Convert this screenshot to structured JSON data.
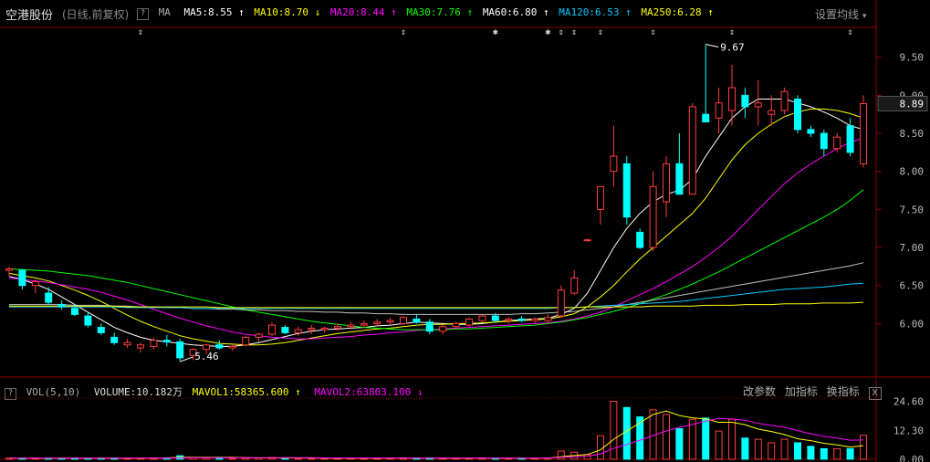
{
  "header": {
    "stock_name": "空港股份",
    "subtitle": "(日线,前复权)",
    "help_icon": "?",
    "ma_label": "MA",
    "ma_items": [
      {
        "label": "MA5:8.55",
        "arrow": "↑",
        "color": "#ffffff"
      },
      {
        "label": "MA10:8.70",
        "arrow": "↓",
        "color": "#ffff00"
      },
      {
        "label": "MA20:8.44",
        "arrow": "↑",
        "color": "#ff00ff"
      },
      {
        "label": "MA30:7.76",
        "arrow": "↑",
        "color": "#00ff00"
      },
      {
        "label": "MA60:6.80",
        "arrow": "↑",
        "color": "#ffffff"
      },
      {
        "label": "MA120:6.53",
        "arrow": "↑",
        "color": "#00c8ff"
      },
      {
        "label": "MA250:6.28",
        "arrow": "↑",
        "color": "#ffff00"
      }
    ],
    "settings_label": "设置均线",
    "settings_arrow": "▾"
  },
  "price_axis": {
    "ticks": [
      "9.50",
      "9.00",
      "8.50",
      "8.00",
      "7.50",
      "7.00",
      "6.50",
      "6.00"
    ],
    "current": "8.89"
  },
  "annotations": {
    "high_label": "9.67",
    "low_label": "5.46"
  },
  "volume": {
    "help_icon": "?",
    "label": "VOL(5,10)",
    "volume_value": "VOLUME:10.182万",
    "mavol1": "MAVOL1:58365.600",
    "mavol1_arrow": "↑",
    "mavol2": "MAVOL2:63803.100",
    "mavol2_arrow": "↓",
    "tools": [
      "改参数",
      "加指标",
      "换指标"
    ],
    "close": "X",
    "ticks": [
      "24.60",
      "12.30",
      "0.00"
    ]
  },
  "colors": {
    "up": "#ff3c3c",
    "down": "#00ffff",
    "grid": "#8b0000",
    "ma5": "#ffffff",
    "ma10": "#ffff00",
    "ma20": "#ff00ff",
    "ma30": "#00ff00",
    "ma60": "#ffffff",
    "ma120": "#00c8ff",
    "ma250": "#ffff00"
  },
  "chart_data": {
    "type": "candlestick",
    "y_range": [
      5.3,
      9.8
    ],
    "candles": [
      [
        6.7,
        6.75,
        6.62,
        6.72
      ],
      [
        6.7,
        6.72,
        6.45,
        6.5
      ],
      [
        6.5,
        6.58,
        6.4,
        6.55
      ],
      [
        6.4,
        6.48,
        6.25,
        6.28
      ],
      [
        6.25,
        6.3,
        6.18,
        6.22
      ],
      [
        6.2,
        6.25,
        6.1,
        6.12
      ],
      [
        6.1,
        6.15,
        5.95,
        5.98
      ],
      [
        5.95,
        6.0,
        5.85,
        5.88
      ],
      [
        5.82,
        5.88,
        5.72,
        5.75
      ],
      [
        5.72,
        5.8,
        5.68,
        5.75
      ],
      [
        5.68,
        5.75,
        5.62,
        5.72
      ],
      [
        5.7,
        5.82,
        5.66,
        5.78
      ],
      [
        5.78,
        5.85,
        5.7,
        5.76
      ],
      [
        5.76,
        5.8,
        5.5,
        5.55
      ],
      [
        5.58,
        5.68,
        5.52,
        5.66
      ],
      [
        5.66,
        5.74,
        5.6,
        5.72
      ],
      [
        5.72,
        5.78,
        5.66,
        5.68
      ],
      [
        5.68,
        5.72,
        5.64,
        5.7
      ],
      [
        5.72,
        5.84,
        5.7,
        5.82
      ],
      [
        5.82,
        5.88,
        5.76,
        5.86
      ],
      [
        5.86,
        6.02,
        5.84,
        5.98
      ],
      [
        5.95,
        5.98,
        5.86,
        5.88
      ],
      [
        5.88,
        5.96,
        5.84,
        5.92
      ],
      [
        5.92,
        5.98,
        5.86,
        5.94
      ],
      [
        5.92,
        5.96,
        5.88,
        5.94
      ],
      [
        5.94,
        6.0,
        5.9,
        5.96
      ],
      [
        5.96,
        6.02,
        5.92,
        5.98
      ],
      [
        5.98,
        6.04,
        5.94,
        6.0
      ],
      [
        6.0,
        6.06,
        5.96,
        6.02
      ],
      [
        6.02,
        6.08,
        5.98,
        6.04
      ],
      [
        6.0,
        6.1,
        5.98,
        6.08
      ],
      [
        6.06,
        6.12,
        6.0,
        6.02
      ],
      [
        6.02,
        6.06,
        5.86,
        5.9
      ],
      [
        5.9,
        5.98,
        5.86,
        5.96
      ],
      [
        5.96,
        6.02,
        5.92,
        6.0
      ],
      [
        5.98,
        6.08,
        5.96,
        6.06
      ],
      [
        6.04,
        6.12,
        6.02,
        6.1
      ],
      [
        6.1,
        6.14,
        6.02,
        6.04
      ],
      [
        6.04,
        6.08,
        6.0,
        6.06
      ],
      [
        6.06,
        6.1,
        6.02,
        6.04
      ],
      [
        6.04,
        6.08,
        6.0,
        6.06
      ],
      [
        6.04,
        6.12,
        6.0,
        6.08
      ],
      [
        6.1,
        6.5,
        6.08,
        6.44
      ],
      [
        6.4,
        6.7,
        6.38,
        6.6
      ],
      [
        7.1,
        7.12,
        7.08,
        7.1
      ],
      [
        7.5,
        7.8,
        7.3,
        7.8
      ],
      [
        8.0,
        8.6,
        7.8,
        8.2
      ],
      [
        8.1,
        8.2,
        7.3,
        7.4
      ],
      [
        7.2,
        7.25,
        6.98,
        7.0
      ],
      [
        7.0,
        8.0,
        6.95,
        7.8
      ],
      [
        7.6,
        8.2,
        7.4,
        8.1
      ],
      [
        8.1,
        8.5,
        7.7,
        7.7
      ],
      [
        7.7,
        8.9,
        7.7,
        8.85
      ],
      [
        8.75,
        9.67,
        8.7,
        8.65
      ],
      [
        8.7,
        9.1,
        8.5,
        8.9
      ],
      [
        8.8,
        9.4,
        8.6,
        9.1
      ],
      [
        9.0,
        9.1,
        8.7,
        8.85
      ],
      [
        8.85,
        9.2,
        8.6,
        8.9
      ],
      [
        8.75,
        9.0,
        8.6,
        8.8
      ],
      [
        8.8,
        9.1,
        8.75,
        9.05
      ],
      [
        8.95,
        9.0,
        8.5,
        8.55
      ],
      [
        8.55,
        8.6,
        8.45,
        8.5
      ],
      [
        8.5,
        8.55,
        8.2,
        8.3
      ],
      [
        8.3,
        8.5,
        8.25,
        8.45
      ],
      [
        8.6,
        8.7,
        8.2,
        8.25
      ],
      [
        8.1,
        9.0,
        8.05,
        8.89
      ]
    ],
    "ma": {
      "ma5": [
        6.62,
        6.58,
        6.52,
        6.45,
        6.35,
        6.25,
        6.15,
        6.05,
        5.95,
        5.88,
        5.82,
        5.78,
        5.76,
        5.74,
        5.72,
        5.71,
        5.7,
        5.7,
        5.72,
        5.75,
        5.79,
        5.83,
        5.87,
        5.9,
        5.92,
        5.93,
        5.94,
        5.95,
        5.97,
        5.98,
        6.0,
        6.02,
        6.01,
        6.0,
        5.99,
        5.99,
        6.0,
        6.02,
        6.04,
        6.05,
        6.06,
        6.07,
        6.12,
        6.2,
        6.4,
        6.7,
        7.0,
        7.25,
        7.45,
        7.6,
        7.7,
        7.75,
        7.9,
        8.2,
        8.45,
        8.7,
        8.85,
        8.95,
        8.95,
        8.95,
        8.9,
        8.85,
        8.78,
        8.7,
        8.6,
        8.55
      ],
      "ma10": [
        6.66,
        6.63,
        6.6,
        6.56,
        6.5,
        6.44,
        6.37,
        6.29,
        6.2,
        6.11,
        6.03,
        5.96,
        5.9,
        5.84,
        5.8,
        5.77,
        5.74,
        5.73,
        5.72,
        5.72,
        5.73,
        5.75,
        5.78,
        5.81,
        5.84,
        5.87,
        5.89,
        5.91,
        5.93,
        5.94,
        5.96,
        5.98,
        5.99,
        5.99,
        6.0,
        6.0,
        6.01,
        6.02,
        6.03,
        6.04,
        6.05,
        6.06,
        6.09,
        6.13,
        6.22,
        6.35,
        6.5,
        6.68,
        6.85,
        7.0,
        7.15,
        7.3,
        7.45,
        7.65,
        7.9,
        8.15,
        8.35,
        8.5,
        8.62,
        8.72,
        8.78,
        8.82,
        8.82,
        8.8,
        8.76,
        8.7
      ],
      "ma20": [
        6.6,
        6.58,
        6.56,
        6.54,
        6.51,
        6.48,
        6.45,
        6.41,
        6.36,
        6.31,
        6.25,
        6.19,
        6.13,
        6.07,
        6.02,
        5.97,
        5.93,
        5.89,
        5.86,
        5.84,
        5.82,
        5.81,
        5.8,
        5.8,
        5.81,
        5.82,
        5.83,
        5.85,
        5.86,
        5.88,
        5.89,
        5.91,
        5.92,
        5.93,
        5.94,
        5.95,
        5.96,
        5.97,
        5.98,
        5.99,
        6.0,
        6.01,
        6.03,
        6.06,
        6.1,
        6.15,
        6.22,
        6.3,
        6.38,
        6.46,
        6.55,
        6.65,
        6.75,
        6.87,
        7.0,
        7.15,
        7.32,
        7.5,
        7.67,
        7.84,
        7.98,
        8.1,
        8.2,
        8.3,
        8.38,
        8.44
      ],
      "ma30": [
        6.72,
        6.71,
        6.7,
        6.69,
        6.67,
        6.65,
        6.63,
        6.6,
        6.57,
        6.54,
        6.5,
        6.46,
        6.42,
        6.38,
        6.34,
        6.3,
        6.26,
        6.22,
        6.18,
        6.15,
        6.12,
        6.09,
        6.06,
        6.03,
        6.01,
        5.99,
        5.97,
        5.95,
        5.94,
        5.93,
        5.92,
        5.92,
        5.92,
        5.92,
        5.93,
        5.93,
        5.94,
        5.95,
        5.96,
        5.97,
        5.98,
        6.0,
        6.02,
        6.05,
        6.08,
        6.12,
        6.16,
        6.21,
        6.26,
        6.32,
        6.38,
        6.45,
        6.52,
        6.6,
        6.68,
        6.77,
        6.86,
        6.95,
        7.04,
        7.13,
        7.22,
        7.31,
        7.4,
        7.5,
        7.62,
        7.76
      ],
      "ma60": [
        6.25,
        6.25,
        6.25,
        6.25,
        6.25,
        6.24,
        6.24,
        6.24,
        6.23,
        6.23,
        6.22,
        6.22,
        6.21,
        6.21,
        6.2,
        6.2,
        6.19,
        6.19,
        6.18,
        6.18,
        6.17,
        6.17,
        6.16,
        6.16,
        6.15,
        6.15,
        6.14,
        6.14,
        6.13,
        6.13,
        6.12,
        6.12,
        6.12,
        6.12,
        6.12,
        6.12,
        6.12,
        6.12,
        6.12,
        6.13,
        6.13,
        6.14,
        6.15,
        6.16,
        6.18,
        6.2,
        6.22,
        6.25,
        6.28,
        6.31,
        6.34,
        6.37,
        6.4,
        6.43,
        6.46,
        6.49,
        6.52,
        6.55,
        6.58,
        6.61,
        6.64,
        6.67,
        6.7,
        6.73,
        6.76,
        6.8
      ],
      "ma120": [
        6.22,
        6.22,
        6.22,
        6.22,
        6.22,
        6.22,
        6.22,
        6.22,
        6.22,
        6.21,
        6.21,
        6.21,
        6.21,
        6.21,
        6.2,
        6.2,
        6.2,
        6.2,
        6.2,
        6.2,
        6.2,
        6.2,
        6.2,
        6.2,
        6.2,
        6.2,
        6.2,
        6.2,
        6.2,
        6.2,
        6.2,
        6.2,
        6.2,
        6.2,
        6.2,
        6.2,
        6.2,
        6.2,
        6.2,
        6.2,
        6.2,
        6.2,
        6.21,
        6.21,
        6.22,
        6.23,
        6.24,
        6.25,
        6.26,
        6.27,
        6.28,
        6.29,
        6.31,
        6.33,
        6.35,
        6.37,
        6.39,
        6.41,
        6.43,
        6.45,
        6.46,
        6.47,
        6.48,
        6.5,
        6.52,
        6.53
      ],
      "ma250": [
        6.23,
        6.23,
        6.23,
        6.23,
        6.23,
        6.23,
        6.23,
        6.23,
        6.23,
        6.22,
        6.22,
        6.22,
        6.22,
        6.22,
        6.22,
        6.22,
        6.21,
        6.21,
        6.21,
        6.21,
        6.21,
        6.21,
        6.21,
        6.21,
        6.21,
        6.21,
        6.21,
        6.21,
        6.21,
        6.21,
        6.21,
        6.21,
        6.21,
        6.21,
        6.21,
        6.21,
        6.21,
        6.21,
        6.21,
        6.21,
        6.21,
        6.21,
        6.21,
        6.21,
        6.22,
        6.22,
        6.22,
        6.22,
        6.22,
        6.23,
        6.23,
        6.23,
        6.23,
        6.24,
        6.24,
        6.24,
        6.25,
        6.25,
        6.25,
        6.26,
        6.26,
        6.26,
        6.27,
        6.27,
        6.27,
        6.28
      ]
    },
    "vol_range": [
      0,
      26
    ],
    "volumes": [
      0.5,
      0.4,
      0.5,
      0.4,
      0.4,
      0.5,
      0.4,
      0.4,
      0.5,
      0.4,
      0.5,
      0.6,
      0.5,
      1.5,
      0.8,
      0.6,
      0.4,
      0.4,
      0.5,
      0.6,
      0.8,
      0.5,
      0.4,
      0.4,
      0.4,
      0.4,
      0.5,
      0.4,
      0.4,
      0.5,
      0.6,
      0.5,
      0.6,
      0.4,
      0.4,
      0.5,
      0.6,
      0.4,
      0.4,
      0.4,
      0.4,
      0.6,
      3.5,
      3.0,
      2.0,
      10.0,
      24.6,
      22.0,
      18.0,
      21.0,
      19.0,
      13.0,
      17.0,
      17.5,
      12.0,
      17.0,
      9.0,
      8.5,
      7.0,
      8.5,
      7.0,
      5.5,
      4.5,
      4.5,
      4.5,
      10.2
    ],
    "mavol1": [
      0.5,
      0.5,
      0.5,
      0.5,
      0.5,
      0.5,
      0.5,
      0.5,
      0.5,
      0.5,
      0.5,
      0.5,
      0.6,
      0.8,
      0.8,
      0.8,
      0.8,
      0.8,
      0.7,
      0.6,
      0.6,
      0.6,
      0.6,
      0.6,
      0.5,
      0.5,
      0.5,
      0.5,
      0.5,
      0.5,
      0.5,
      0.5,
      0.5,
      0.5,
      0.5,
      0.5,
      0.5,
      0.5,
      0.5,
      0.5,
      0.5,
      0.5,
      1.1,
      1.6,
      2.0,
      4.0,
      8.5,
      12.0,
      15.5,
      19.0,
      20.5,
      18.6,
      17.6,
      17.1,
      15.7,
      15.7,
      14.7,
      12.8,
      11.8,
      10.5,
      8.7,
      7.9,
      6.8,
      6.1,
      5.2,
      5.8
    ],
    "mavol2": [
      0.5,
      0.5,
      0.5,
      0.5,
      0.5,
      0.5,
      0.5,
      0.5,
      0.5,
      0.5,
      0.5,
      0.5,
      0.5,
      0.6,
      0.7,
      0.7,
      0.7,
      0.7,
      0.7,
      0.7,
      0.7,
      0.7,
      0.7,
      0.7,
      0.6,
      0.6,
      0.6,
      0.6,
      0.6,
      0.5,
      0.5,
      0.5,
      0.5,
      0.5,
      0.5,
      0.5,
      0.5,
      0.5,
      0.5,
      0.5,
      0.5,
      0.5,
      0.8,
      1.1,
      1.3,
      2.3,
      4.6,
      6.3,
      8.1,
      10.1,
      12.0,
      13.6,
      14.8,
      16.2,
      17.4,
      17.1,
      16.6,
      15.2,
      14.4,
      13.6,
      12.2,
      10.8,
      9.8,
      9.0,
      8.1,
      8.2
    ]
  }
}
